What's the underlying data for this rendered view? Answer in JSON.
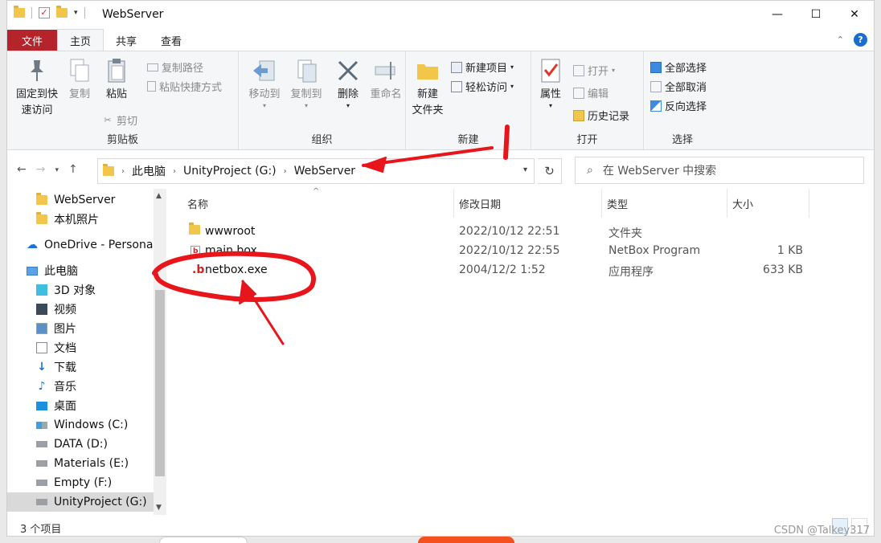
{
  "window": {
    "title": "WebServer",
    "controls": {
      "minimize": "—",
      "maximize": "☐",
      "close": "✕"
    }
  },
  "ribbon_tabs": [
    {
      "label": "文件"
    },
    {
      "label": "主页"
    },
    {
      "label": "共享"
    },
    {
      "label": "查看"
    }
  ],
  "ribbon": {
    "clipboard": {
      "group_label": "剪贴板",
      "pin_line1": "固定到快",
      "pin_line2": "速访问",
      "copy": "复制",
      "paste": "粘贴",
      "copy_path": "复制路径",
      "paste_shortcut": "粘贴快捷方式",
      "cut": "剪切"
    },
    "organize": {
      "group_label": "组织",
      "move_to": "移动到",
      "copy_to": "复制到",
      "delete": "删除",
      "rename": "重命名"
    },
    "new": {
      "group_label": "新建",
      "new_item": "新建项目",
      "easy_access": "轻松访问",
      "new_folder_line1": "新建",
      "new_folder_line2": "文件夹"
    },
    "open": {
      "group_label": "打开",
      "properties": "属性",
      "open": "打开",
      "edit": "编辑",
      "history": "历史记录"
    },
    "select": {
      "group_label": "选择",
      "select_all": "全部选择",
      "select_none": "全部取消",
      "invert": "反向选择"
    }
  },
  "address": {
    "crumbs": [
      "此电脑",
      "UnityProject (G:)",
      "WebServer"
    ],
    "search_placeholder": "在 WebServer 中搜索"
  },
  "nav_pane": [
    {
      "label": "WebServer",
      "icon": "folder-icon"
    },
    {
      "label": "本机照片",
      "icon": "folder-icon"
    },
    {
      "label": "OneDrive - Persona",
      "icon": "cloud-icon"
    },
    {
      "label": "此电脑",
      "icon": "computer-icon"
    },
    {
      "label": "3D 对象",
      "icon": "cube-icon"
    },
    {
      "label": "视频",
      "icon": "video-icon"
    },
    {
      "label": "图片",
      "icon": "picture-icon"
    },
    {
      "label": "文档",
      "icon": "document-icon"
    },
    {
      "label": "下载",
      "icon": "download-icon"
    },
    {
      "label": "音乐",
      "icon": "music-icon"
    },
    {
      "label": "桌面",
      "icon": "desktop-icon"
    },
    {
      "label": "Windows (C:)",
      "icon": "windows-drive-icon"
    },
    {
      "label": "DATA (D:)",
      "icon": "drive-icon"
    },
    {
      "label": "Materials (E:)",
      "icon": "drive-icon"
    },
    {
      "label": "Empty (F:)",
      "icon": "drive-icon"
    },
    {
      "label": "UnityProject (G:)",
      "icon": "drive-icon"
    }
  ],
  "columns": [
    "名称",
    "修改日期",
    "类型",
    "大小"
  ],
  "files": [
    {
      "name": "wwwroot",
      "modified": "2022/10/12 22:51",
      "type": "文件夹",
      "size": ""
    },
    {
      "name": "main.box",
      "modified": "2022/10/12 22:55",
      "type": "NetBox Program",
      "size": "1 KB"
    },
    {
      "name": "netbox.exe",
      "modified": "2004/12/2 1:52",
      "type": "应用程序",
      "size": "633 KB"
    }
  ],
  "status": {
    "count": "3 个项目"
  },
  "watermark": "CSDN @Talkey317",
  "colors": {
    "file_tab": "#b5242b",
    "annotation": "#e8151b",
    "accent": "#1c6dd0"
  }
}
